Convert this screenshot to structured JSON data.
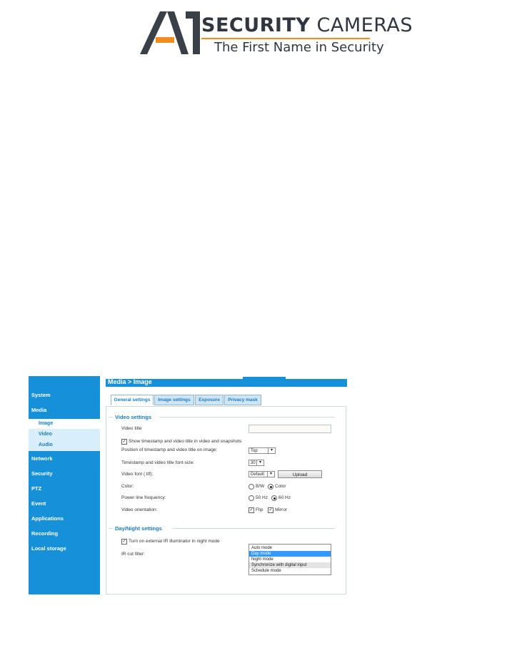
{
  "logo": {
    "brand_bold": "SECURITY",
    "brand_light": "CAMERAS",
    "tagline": "The First Name in Security",
    "accent_color": "#f28c1e"
  },
  "header": {
    "breadcrumb": "Media  > Image"
  },
  "sidebar": {
    "items": [
      "System",
      "Media",
      "Network",
      "Security",
      "PTZ",
      "Event",
      "Applications",
      "Recording",
      "Local storage"
    ],
    "media_subitems": [
      "Image",
      "Video",
      "Audio"
    ],
    "active_subitem": "Image"
  },
  "tabs": [
    "General settings",
    "Image settings",
    "Exposure",
    "Privacy mask"
  ],
  "video_settings": {
    "title": "Video settings",
    "video_title_label": "Video title",
    "video_title_value": "",
    "show_timestamp_label": "Show timestamp and video title in video and snapshots",
    "show_timestamp_checked": true,
    "position_label": "Position of timestamp and video title on image:",
    "position_value": "Top",
    "font_size_label": "Timestamp and video title font-size:",
    "font_size_value": "30",
    "video_font_label": "Video font (.ttf):",
    "video_font_value": "Default",
    "upload_label": "Upload",
    "color_label": "Color:",
    "color_options": [
      "B/W",
      "Color"
    ],
    "color_value": "Color",
    "power_label": "Power line frequency:",
    "power_options": [
      "50 Hz",
      "60 Hz"
    ],
    "power_value": "60 Hz",
    "orientation_label": "Video orientation:",
    "flip_label": "Flip",
    "flip_checked": true,
    "mirror_label": "Mirror",
    "mirror_checked": true
  },
  "day_night": {
    "title": "Day/Night settings",
    "ir_illuminator_label": "Turn on external IR illuminator in night mode",
    "ir_illuminator_checked": true,
    "ir_cut_label": "IR cut filter:",
    "ir_cut_options": [
      "Auto mode",
      "Day mode",
      "Night mode",
      "Synchronize with digital input",
      "Schedule mode"
    ],
    "ir_cut_selected": "Day mode"
  },
  "colors": {
    "nav_blue": "#1691d9",
    "link_blue": "#1a7cc2",
    "selection": "#3399ff"
  }
}
